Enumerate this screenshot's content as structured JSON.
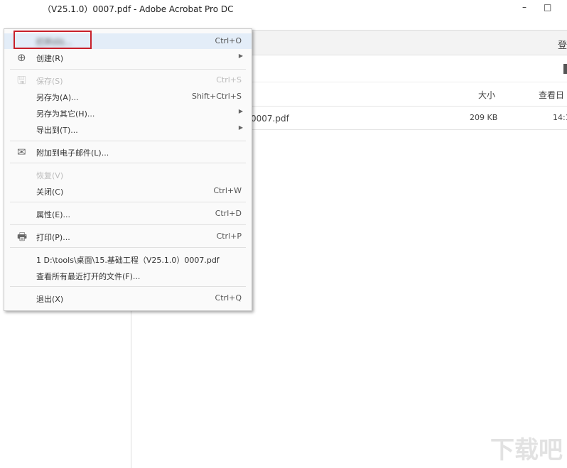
{
  "window": {
    "title": "（V25.1.0）0007.pdf - Adobe Acrobat Pro DC",
    "minimize": "–",
    "maximize": "□"
  },
  "header": {
    "login": "登"
  },
  "columns": {
    "size": "大小",
    "viewed": "查看日"
  },
  "file": {
    "name": "0007.pdf",
    "size": "209 KB",
    "time": "14:1"
  },
  "menu": {
    "open": {
      "label": "打开(O)...",
      "shortcut": "Ctrl+O"
    },
    "create": {
      "label": "创建(R)"
    },
    "save": {
      "label": "保存(S)",
      "shortcut": "Ctrl+S"
    },
    "saveas": {
      "label": "另存为(A)...",
      "shortcut": "Shift+Ctrl+S"
    },
    "saveother": {
      "label": "另存为其它(H)..."
    },
    "export": {
      "label": "导出到(T)..."
    },
    "email": {
      "label": "附加到电子邮件(L)..."
    },
    "revert": {
      "label": "恢复(V)"
    },
    "close": {
      "label": "关闭(C)",
      "shortcut": "Ctrl+W"
    },
    "props": {
      "label": "属性(E)...",
      "shortcut": "Ctrl+D"
    },
    "print": {
      "label": "打印(P)...",
      "shortcut": "Ctrl+P"
    },
    "recent1": {
      "label": "1 D:\\tools\\桌面\\15.基础工程（V25.1.0）0007.pdf"
    },
    "viewall": {
      "label": "查看所有最近打开的文件(F)..."
    },
    "exit": {
      "label": "退出(X)",
      "shortcut": "Ctrl+Q"
    }
  },
  "watermark": "下载吧"
}
